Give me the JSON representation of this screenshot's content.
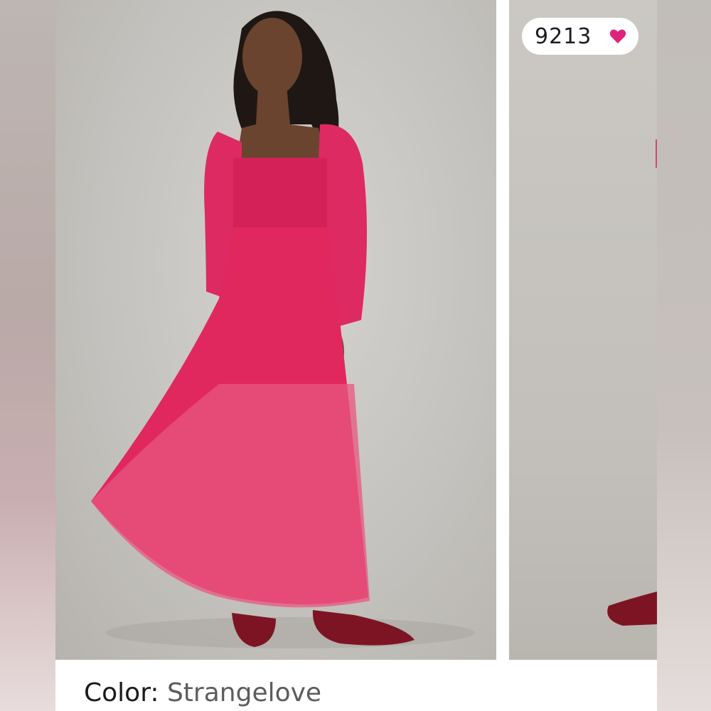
{
  "listing": {
    "like_count": "9213",
    "heart_icon": "heart-icon",
    "accent_color": "#e0227d",
    "dress_color": "#e0285f",
    "shoe_color": "#7d1424"
  },
  "details": {
    "color_label": "Color:",
    "color_value": "Strangelove"
  }
}
